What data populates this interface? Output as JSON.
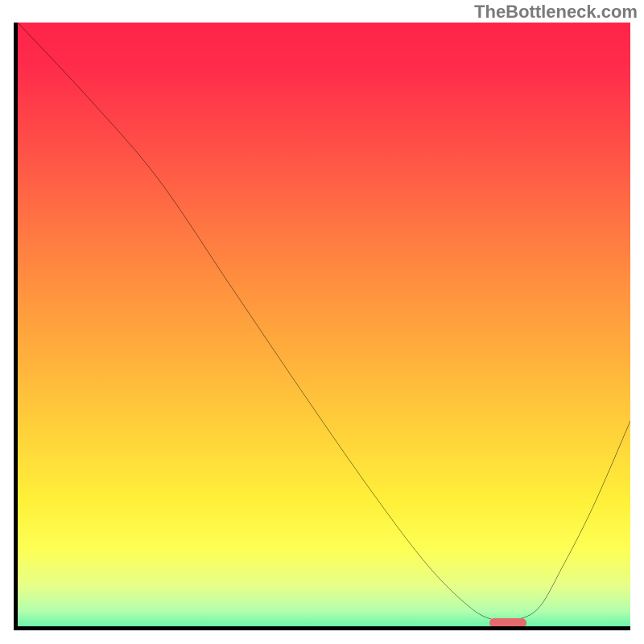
{
  "watermark": "TheBottleneck.com",
  "chart_data": {
    "type": "line",
    "title": "",
    "xlabel": "",
    "ylabel": "",
    "xlim": [
      0,
      100
    ],
    "ylim": [
      0,
      100
    ],
    "x": [
      0,
      12,
      23,
      35,
      47,
      58,
      67,
      74,
      78,
      81,
      85,
      89,
      94,
      100
    ],
    "values": [
      100,
      87,
      74,
      56,
      38,
      22,
      10,
      3,
      1,
      1,
      3,
      10,
      20,
      34
    ],
    "min_marker": {
      "x_start": 77,
      "x_end": 83,
      "y": 0.6
    },
    "gradient_stops": [
      {
        "offset": 0.0,
        "color": "#ff2448"
      },
      {
        "offset": 0.07,
        "color": "#ff2b4a"
      },
      {
        "offset": 0.18,
        "color": "#ff4948"
      },
      {
        "offset": 0.3,
        "color": "#ff6c44"
      },
      {
        "offset": 0.42,
        "color": "#ff8e3f"
      },
      {
        "offset": 0.55,
        "color": "#ffb13c"
      },
      {
        "offset": 0.67,
        "color": "#ffd23a"
      },
      {
        "offset": 0.78,
        "color": "#fff039"
      },
      {
        "offset": 0.86,
        "color": "#fdff55"
      },
      {
        "offset": 0.92,
        "color": "#e6ff89"
      },
      {
        "offset": 0.96,
        "color": "#b4ffad"
      },
      {
        "offset": 0.985,
        "color": "#6cf5ab"
      },
      {
        "offset": 1.0,
        "color": "#2bdd92"
      }
    ]
  }
}
